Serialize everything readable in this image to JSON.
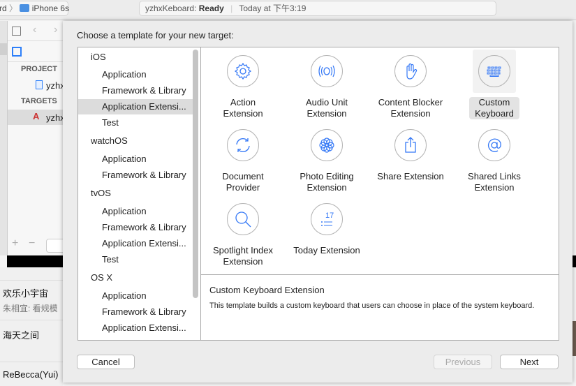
{
  "toolbar": {
    "scheme_prefix": "rd",
    "device": "iPhone 6s",
    "status_target": "yzhxKeboard:",
    "status_state": "Ready",
    "status_time": "Today at 下午3:19"
  },
  "navigator": {
    "project_header": "PROJECT",
    "project_item": "yzhx",
    "targets_header": "TARGETS",
    "target_item": "yzhx"
  },
  "chat": {
    "items": [
      "欢乐小宇宙",
      "朱相宜: 看规模",
      "海天之间",
      "ReBecca(Yui)"
    ]
  },
  "sheet": {
    "title": "Choose a template for your new target:",
    "categories": [
      {
        "label": "iOS",
        "header": true
      },
      {
        "label": "Application"
      },
      {
        "label": "Framework & Library"
      },
      {
        "label": "Application Extensi...",
        "selected": true
      },
      {
        "label": "Test"
      },
      {
        "label": "watchOS",
        "header": true
      },
      {
        "label": "Application"
      },
      {
        "label": "Framework & Library"
      },
      {
        "label": "tvOS",
        "header": true
      },
      {
        "label": "Application"
      },
      {
        "label": "Framework & Library"
      },
      {
        "label": "Application Extensi..."
      },
      {
        "label": "Test"
      },
      {
        "label": "OS X",
        "header": true
      },
      {
        "label": "Application"
      },
      {
        "label": "Framework & Library"
      },
      {
        "label": "Application Extensi..."
      }
    ],
    "templates": [
      {
        "label1": "Action",
        "label2": "Extension",
        "icon": "gear-icon"
      },
      {
        "label1": "Audio Unit",
        "label2": "Extension",
        "icon": "audio-wave-icon"
      },
      {
        "label1": "Content Blocker",
        "label2": "Extension",
        "icon": "hand-icon"
      },
      {
        "label1": "Custom",
        "label2": "Keyboard",
        "icon": "keyboard-icon",
        "selected": true
      },
      {
        "label1": "Document",
        "label2": "Provider",
        "icon": "sync-icon"
      },
      {
        "label1": "Photo Editing",
        "label2": "Extension",
        "icon": "flower-icon"
      },
      {
        "label1": "Share Extension",
        "label2": "",
        "icon": "share-icon"
      },
      {
        "label1": "Shared Links",
        "label2": "Extension",
        "icon": "at-icon"
      },
      {
        "label1": "Spotlight Index",
        "label2": "Extension",
        "icon": "search-icon"
      },
      {
        "label1": "Today Extension",
        "label2": "",
        "icon": "calendar-list-icon",
        "icon_text": "17"
      }
    ],
    "description_title": "Custom Keyboard Extension",
    "description_text": "This template builds a custom keyboard that users can choose in place of the system keyboard.",
    "cancel": "Cancel",
    "previous": "Previous",
    "next": "Next"
  },
  "colors": {
    "accent": "#3478f6"
  }
}
